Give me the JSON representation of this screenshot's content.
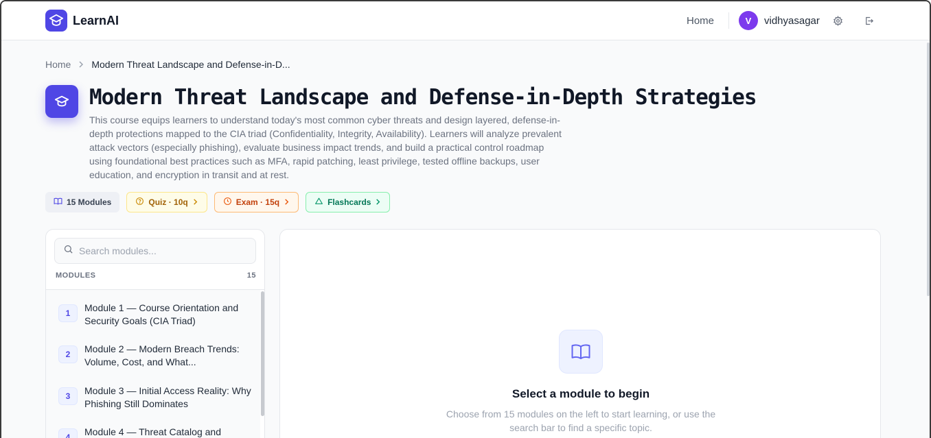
{
  "app": {
    "name": "LearnAI"
  },
  "header": {
    "nav_home": "Home",
    "avatar_initial": "V",
    "username": "vidhyasagar",
    "icons": [
      "settings-icon",
      "logout-icon"
    ]
  },
  "breadcrumb": {
    "home": "Home",
    "current": "Modern Threat Landscape and Defense-in-D..."
  },
  "course": {
    "title": "Modern Threat Landscape and Defense-in-Depth Strategies",
    "description": "This course equips learners to understand today's most common cyber threats and design layered, defense-in-depth protections mapped to the CIA triad (Confidentiality, Integrity, Availability). Learners will analyze prevalent attack vectors (especially phishing), evaluate business impact trends, and build a practical control roadmap using foundational best practices such as MFA, rapid patching, least privilege, tested offline backups, user education, and encryption in transit and at rest."
  },
  "chips": {
    "modules": "15 Modules",
    "quiz": "Quiz · 10q",
    "exam": "Exam · 15q",
    "flashcards": "Flashcards"
  },
  "sidebar": {
    "search_placeholder": "Search modules...",
    "header_label": "MODULES",
    "count": "15",
    "modules": [
      {
        "num": "1",
        "label": "Module 1 — Course Orientation and Security Goals (CIA Triad)"
      },
      {
        "num": "2",
        "label": "Module 2 — Modern Breach Trends: Volume, Cost, and What..."
      },
      {
        "num": "3",
        "label": "Module 3 — Initial Access Reality: Why Phishing Still Dominates"
      },
      {
        "num": "4",
        "label": "Module 4 — Threat Catalog and"
      }
    ]
  },
  "main": {
    "empty_title": "Select a module to begin",
    "empty_text": "Choose from 15 modules on the left to start learning, or use the search bar to find a specific topic."
  },
  "colors": {
    "accent": "#4f46e5",
    "avatar": "#7c3aed"
  }
}
